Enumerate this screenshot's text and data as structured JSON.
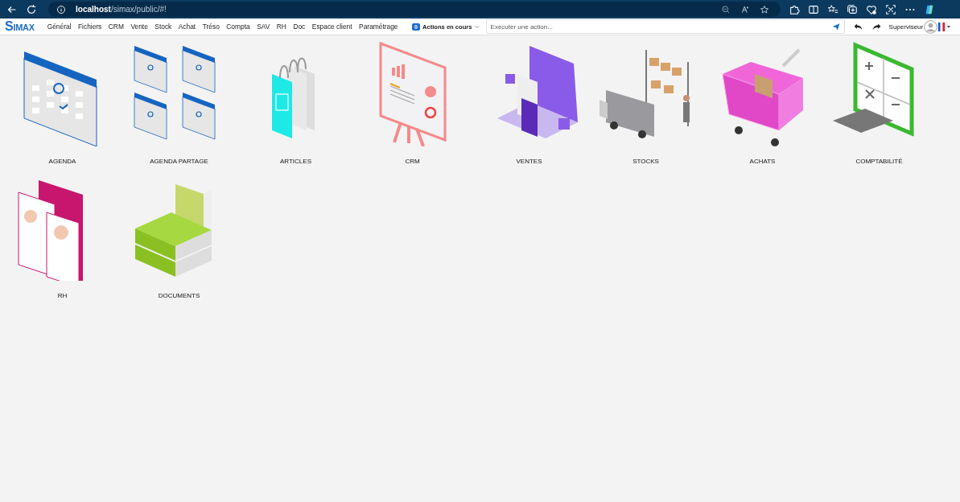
{
  "browser": {
    "url_host": "localhost",
    "url_path": "/simax/public/#!"
  },
  "app": {
    "logo": "SIMAX",
    "menu": [
      "Général",
      "Fichiers",
      "CRM",
      "Vente",
      "Stock",
      "Achat",
      "Tréso",
      "Compta",
      "SAV",
      "RH",
      "Doc",
      "Espace client",
      "Paramétrage"
    ],
    "actions": {
      "count": "0",
      "label": "Actions en cours"
    },
    "command": {
      "placeholder": "Executer une action..."
    },
    "user": "Superviseur"
  },
  "modules": [
    {
      "label": "AGENDA",
      "kind": "calendar"
    },
    {
      "label": "AGENDA PARTAGE",
      "kind": "calendars"
    },
    {
      "label": "ARTICLES",
      "kind": "tags"
    },
    {
      "label": "CRM",
      "kind": "board"
    },
    {
      "label": "VENTES",
      "kind": "laptop"
    },
    {
      "label": "STOCKS",
      "kind": "truck"
    },
    {
      "label": "ACHATS",
      "kind": "cart"
    },
    {
      "label": "COMPTABILITÉ",
      "kind": "calculator"
    },
    {
      "label": "RH",
      "kind": "profiles"
    },
    {
      "label": "DOCUMENTS",
      "kind": "binders"
    }
  ]
}
